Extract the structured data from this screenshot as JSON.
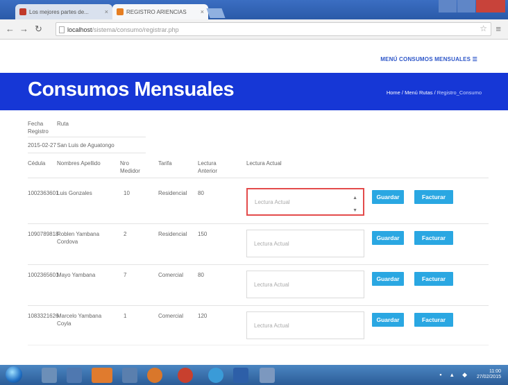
{
  "browser": {
    "tabs": [
      {
        "label": "Los mejores partes de..."
      },
      {
        "label": "REGISTRO ARIENCIAS"
      }
    ],
    "url_host": "localhost",
    "url_path": "/sistema/consumo/registrar.php"
  },
  "nav": {
    "menu_link": "MENÚ CONSUMOS MENSUALES ☰"
  },
  "banner": {
    "title": "Consumos Mensuales",
    "breadcrumb_home": "Home",
    "breadcrumb_menu": "Menú Rutas",
    "breadcrumb_current": "Registro_Consumo"
  },
  "header_info": {
    "col1_label": "Fecha Registro",
    "col2_label": "Ruta",
    "fecha": "2015-02-27",
    "ruta": "San Luis de Aguatongo"
  },
  "table": {
    "columns": [
      "Cédula",
      "Nombres Apellido",
      "Nro Medidor",
      "Tarifa",
      "Lectura Anterior",
      "Lectura Actual"
    ],
    "rows": [
      {
        "cedula": "1002363601",
        "nombre": "Luis Gonzales",
        "medidor": "10",
        "tarifa": "Residencial",
        "anterior": "80"
      },
      {
        "cedula": "1090789818",
        "nombre": "Roblen Yambana Cordova",
        "medidor": "2",
        "tarifa": "Residencial",
        "anterior": "150"
      },
      {
        "cedula": "1002365601",
        "nombre": "Mayo Yambana",
        "medidor": "7",
        "tarifa": "Comercial",
        "anterior": "80"
      },
      {
        "cedula": "1083321626",
        "nombre": "Marcelo Yambana Coyla",
        "medidor": "1",
        "tarifa": "Comercial",
        "anterior": "120"
      }
    ],
    "input_placeholder": "Lectura Actual",
    "save_label": "Guardar",
    "invoice_label": "Facturar"
  },
  "taskbar": {
    "time": "11:00",
    "date": "27/02/2015"
  },
  "colors": {
    "banner": "#1637d6",
    "button": "#2aa7e2",
    "focus_border": "#e34a4a"
  }
}
